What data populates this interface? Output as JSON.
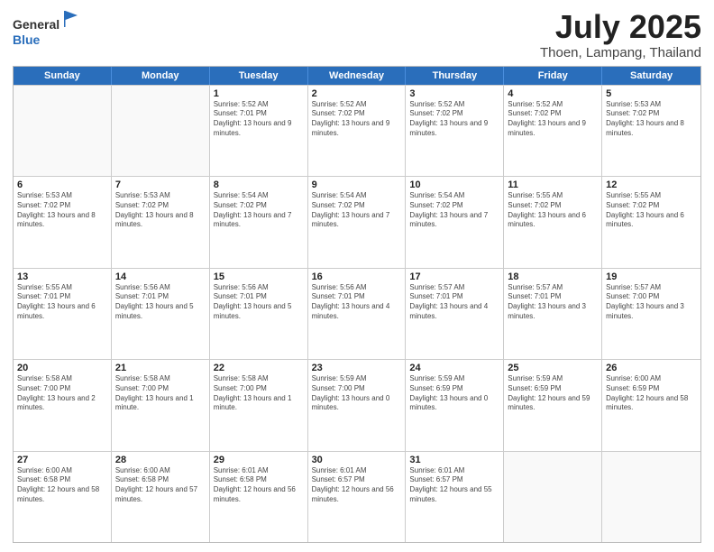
{
  "header": {
    "logo_general": "General",
    "logo_blue": "Blue",
    "month": "July 2025",
    "location": "Thoen, Lampang, Thailand"
  },
  "days_of_week": [
    "Sunday",
    "Monday",
    "Tuesday",
    "Wednesday",
    "Thursday",
    "Friday",
    "Saturday"
  ],
  "rows": [
    [
      {
        "day": "",
        "text": "",
        "empty": true
      },
      {
        "day": "",
        "text": "",
        "empty": true
      },
      {
        "day": "1",
        "text": "Sunrise: 5:52 AM\nSunset: 7:01 PM\nDaylight: 13 hours and 9 minutes."
      },
      {
        "day": "2",
        "text": "Sunrise: 5:52 AM\nSunset: 7:02 PM\nDaylight: 13 hours and 9 minutes."
      },
      {
        "day": "3",
        "text": "Sunrise: 5:52 AM\nSunset: 7:02 PM\nDaylight: 13 hours and 9 minutes."
      },
      {
        "day": "4",
        "text": "Sunrise: 5:52 AM\nSunset: 7:02 PM\nDaylight: 13 hours and 9 minutes."
      },
      {
        "day": "5",
        "text": "Sunrise: 5:53 AM\nSunset: 7:02 PM\nDaylight: 13 hours and 8 minutes."
      }
    ],
    [
      {
        "day": "6",
        "text": "Sunrise: 5:53 AM\nSunset: 7:02 PM\nDaylight: 13 hours and 8 minutes."
      },
      {
        "day": "7",
        "text": "Sunrise: 5:53 AM\nSunset: 7:02 PM\nDaylight: 13 hours and 8 minutes."
      },
      {
        "day": "8",
        "text": "Sunrise: 5:54 AM\nSunset: 7:02 PM\nDaylight: 13 hours and 7 minutes."
      },
      {
        "day": "9",
        "text": "Sunrise: 5:54 AM\nSunset: 7:02 PM\nDaylight: 13 hours and 7 minutes."
      },
      {
        "day": "10",
        "text": "Sunrise: 5:54 AM\nSunset: 7:02 PM\nDaylight: 13 hours and 7 minutes."
      },
      {
        "day": "11",
        "text": "Sunrise: 5:55 AM\nSunset: 7:02 PM\nDaylight: 13 hours and 6 minutes."
      },
      {
        "day": "12",
        "text": "Sunrise: 5:55 AM\nSunset: 7:02 PM\nDaylight: 13 hours and 6 minutes."
      }
    ],
    [
      {
        "day": "13",
        "text": "Sunrise: 5:55 AM\nSunset: 7:01 PM\nDaylight: 13 hours and 6 minutes."
      },
      {
        "day": "14",
        "text": "Sunrise: 5:56 AM\nSunset: 7:01 PM\nDaylight: 13 hours and 5 minutes."
      },
      {
        "day": "15",
        "text": "Sunrise: 5:56 AM\nSunset: 7:01 PM\nDaylight: 13 hours and 5 minutes."
      },
      {
        "day": "16",
        "text": "Sunrise: 5:56 AM\nSunset: 7:01 PM\nDaylight: 13 hours and 4 minutes."
      },
      {
        "day": "17",
        "text": "Sunrise: 5:57 AM\nSunset: 7:01 PM\nDaylight: 13 hours and 4 minutes."
      },
      {
        "day": "18",
        "text": "Sunrise: 5:57 AM\nSunset: 7:01 PM\nDaylight: 13 hours and 3 minutes."
      },
      {
        "day": "19",
        "text": "Sunrise: 5:57 AM\nSunset: 7:00 PM\nDaylight: 13 hours and 3 minutes."
      }
    ],
    [
      {
        "day": "20",
        "text": "Sunrise: 5:58 AM\nSunset: 7:00 PM\nDaylight: 13 hours and 2 minutes."
      },
      {
        "day": "21",
        "text": "Sunrise: 5:58 AM\nSunset: 7:00 PM\nDaylight: 13 hours and 1 minute."
      },
      {
        "day": "22",
        "text": "Sunrise: 5:58 AM\nSunset: 7:00 PM\nDaylight: 13 hours and 1 minute."
      },
      {
        "day": "23",
        "text": "Sunrise: 5:59 AM\nSunset: 7:00 PM\nDaylight: 13 hours and 0 minutes."
      },
      {
        "day": "24",
        "text": "Sunrise: 5:59 AM\nSunset: 6:59 PM\nDaylight: 13 hours and 0 minutes."
      },
      {
        "day": "25",
        "text": "Sunrise: 5:59 AM\nSunset: 6:59 PM\nDaylight: 12 hours and 59 minutes."
      },
      {
        "day": "26",
        "text": "Sunrise: 6:00 AM\nSunset: 6:59 PM\nDaylight: 12 hours and 58 minutes."
      }
    ],
    [
      {
        "day": "27",
        "text": "Sunrise: 6:00 AM\nSunset: 6:58 PM\nDaylight: 12 hours and 58 minutes."
      },
      {
        "day": "28",
        "text": "Sunrise: 6:00 AM\nSunset: 6:58 PM\nDaylight: 12 hours and 57 minutes."
      },
      {
        "day": "29",
        "text": "Sunrise: 6:01 AM\nSunset: 6:58 PM\nDaylight: 12 hours and 56 minutes."
      },
      {
        "day": "30",
        "text": "Sunrise: 6:01 AM\nSunset: 6:57 PM\nDaylight: 12 hours and 56 minutes."
      },
      {
        "day": "31",
        "text": "Sunrise: 6:01 AM\nSunset: 6:57 PM\nDaylight: 12 hours and 55 minutes."
      },
      {
        "day": "",
        "text": "",
        "empty": true
      },
      {
        "day": "",
        "text": "",
        "empty": true
      }
    ]
  ]
}
